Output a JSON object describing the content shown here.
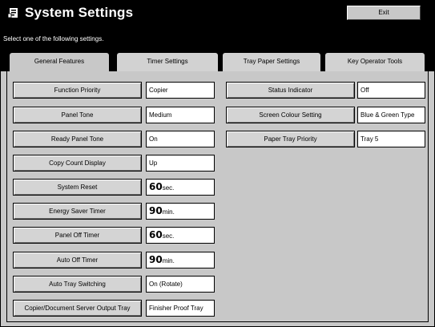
{
  "header": {
    "title": "System Settings",
    "exit_label": "Exit",
    "icon": "settings-icon"
  },
  "instruction": "Select one of the following settings.",
  "tabs": [
    {
      "label": "General Features",
      "active": true
    },
    {
      "label": "Timer Settings",
      "active": false
    },
    {
      "label": "Tray Paper Settings",
      "active": false
    },
    {
      "label": "Key Operator Tools",
      "active": false
    }
  ],
  "left_settings": [
    {
      "label": "Function Priority",
      "value": "Copier"
    },
    {
      "label": "Panel Tone",
      "value": "Medium"
    },
    {
      "label": "Ready Panel Tone",
      "value": "On"
    },
    {
      "label": "Copy Count Display",
      "value": "Up"
    },
    {
      "label": "System Reset",
      "number": "60",
      "unit": "sec."
    },
    {
      "label": "Energy Saver Timer",
      "number": "90",
      "unit": "min."
    },
    {
      "label": "Panel Off Timer",
      "number": "60",
      "unit": "sec."
    },
    {
      "label": "Auto Off Timer",
      "number": "90",
      "unit": "min."
    },
    {
      "label": "Auto Tray Switching",
      "value": "On (Rotate)"
    },
    {
      "label": "Copier/Document Server Output Tray",
      "value": "Finisher Proof Tray"
    }
  ],
  "right_settings": [
    {
      "label": "Status Indicator",
      "value": "Off"
    },
    {
      "label": "Screen Colour Setting",
      "value": "Blue & Green Type"
    },
    {
      "label": "Paper Tray Priority",
      "value": "Tray 5"
    }
  ]
}
